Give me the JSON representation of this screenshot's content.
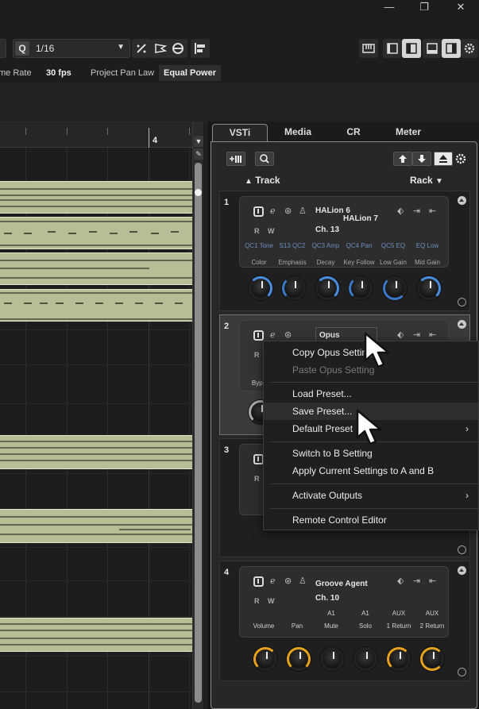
{
  "window": {
    "minimize": "—",
    "maximize": "❐",
    "close": "✕"
  },
  "toolbar": {
    "quantize_label": "Q",
    "quantize_value": "1/16",
    "frame_rate_label": "me Rate",
    "frame_rate_value": "30 fps",
    "pan_law_label": "Project Pan Law",
    "pan_law_value": "Equal Power"
  },
  "ruler": {
    "bar_number": "4"
  },
  "tabs": [
    "VSTi",
    "Media",
    "CR",
    "Meter"
  ],
  "rack": {
    "track_label": "Track",
    "rack_label": "Rack"
  },
  "slots": [
    {
      "number": "1",
      "name_line1": "HALion 6",
      "name_line2": "HALion 7",
      "preset": "Ch. 13",
      "qc_top": [
        "QC1 Tone",
        "S13 QC2",
        "QC3 Amp",
        "QC4 Pan",
        "QC5 EQ",
        "EQ Low"
      ],
      "qc_bottom": [
        "Color",
        "Emphasis",
        "Decay",
        "Key Follow",
        "Low Gain",
        "Mid Gain"
      ]
    },
    {
      "number": "2",
      "name": "Opus",
      "partial_label": "Bypa"
    },
    {
      "number": "3"
    },
    {
      "number": "4",
      "name": "Groove Agent",
      "preset": "Ch. 10",
      "top_labels": [
        "A1",
        "A1",
        "AUX",
        "AUX"
      ],
      "bottom_labels": [
        "Volume",
        "Pan",
        "Mute",
        "Solo",
        "1 Return",
        "2 Return"
      ]
    }
  ],
  "context_menu": {
    "copy": "Copy Opus Setting",
    "paste": "Paste Opus Setting",
    "load": "Load Preset...",
    "save": "Save Preset...",
    "default": "Default Preset",
    "switch_b": "Switch to B Setting",
    "apply_ab": "Apply Current Settings to A and B",
    "activate": "Activate Outputs",
    "remote": "Remote Control Editor"
  },
  "colors": {
    "accent_blue": "#3a78c8",
    "accent_orange": "#e6a21c",
    "part_fill": "#b9bd96"
  }
}
